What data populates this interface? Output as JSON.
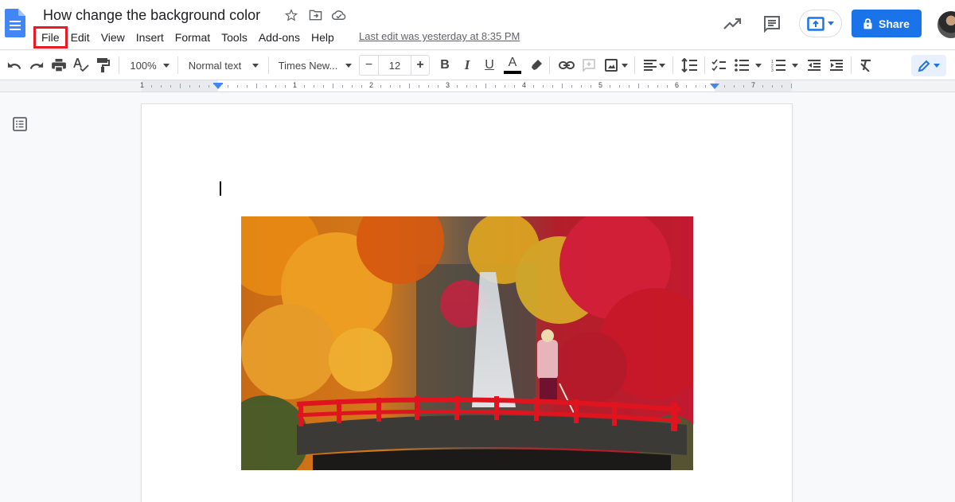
{
  "app": {
    "name": "Google Docs",
    "document_title": "How change the background color",
    "last_edit": "Last edit was yesterday at 8:35 PM"
  },
  "menu": {
    "items": [
      {
        "label": "File",
        "highlighted": true
      },
      {
        "label": "Edit"
      },
      {
        "label": "View"
      },
      {
        "label": "Insert"
      },
      {
        "label": "Format"
      },
      {
        "label": "Tools"
      },
      {
        "label": "Add-ons"
      },
      {
        "label": "Help"
      }
    ]
  },
  "header_actions": {
    "share_label": "Share",
    "share_color": "#1a73e8",
    "highlight_color": "#e51c23"
  },
  "toolbar": {
    "zoom": "100%",
    "style": "Normal text",
    "font": "Times New...",
    "font_size": "12",
    "decrease": "−",
    "increase": "+",
    "bold": "B",
    "italic": "I",
    "underline": "U",
    "text_color_glyph": "A"
  },
  "ruler": {
    "labels": [
      "1",
      "1",
      "2",
      "3",
      "4",
      "5",
      "6",
      "7"
    ]
  },
  "document": {
    "image_description": "Autumn waterfall with red bridge and figure"
  }
}
